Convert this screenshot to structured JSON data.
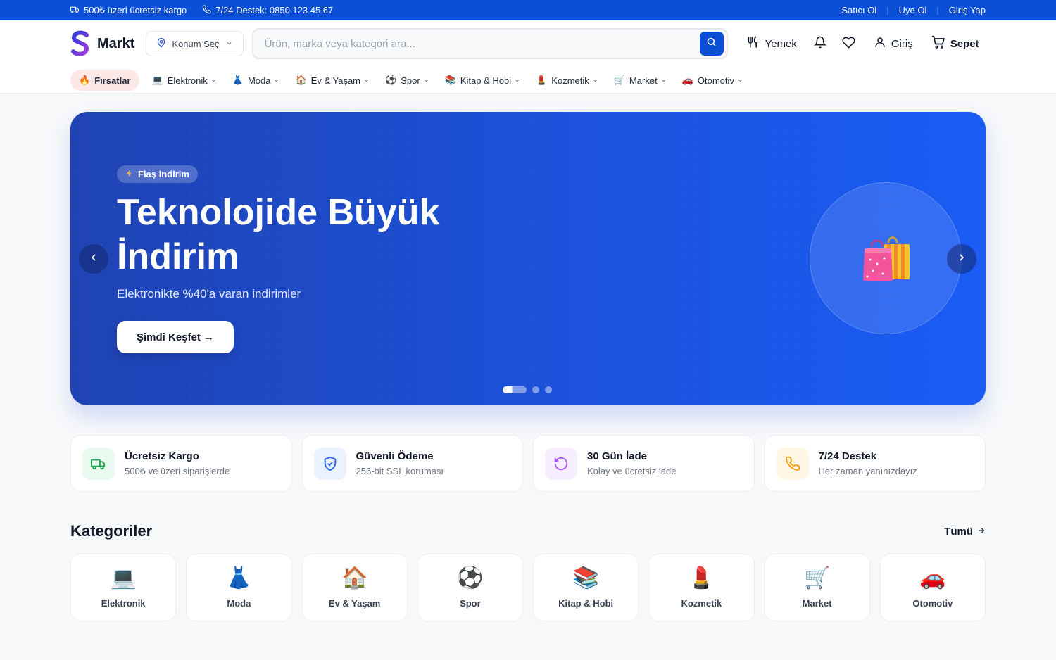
{
  "topbar": {
    "shipping": "500₺ üzeri ücretsiz kargo",
    "support": "7/24 Destek: 0850 123 45 67",
    "links": [
      "Satıcı Ol",
      "Üye Ol",
      "Giriş Yap"
    ]
  },
  "header": {
    "brand": "Markt",
    "location_label": "Konum Seç",
    "search_placeholder": "Ürün, marka veya kategori ara...",
    "actions": {
      "food": "Yemek",
      "login": "Giriş",
      "cart": "Sepet"
    }
  },
  "nav": {
    "deals": {
      "emoji": "🔥",
      "label": "Fırsatlar"
    },
    "items": [
      {
        "emoji": "💻",
        "label": "Elektronik"
      },
      {
        "emoji": "👗",
        "label": "Moda"
      },
      {
        "emoji": "🏠",
        "label": "Ev & Yaşam"
      },
      {
        "emoji": "⚽",
        "label": "Spor"
      },
      {
        "emoji": "📚",
        "label": "Kitap & Hobi"
      },
      {
        "emoji": "💄",
        "label": "Kozmetik"
      },
      {
        "emoji": "🛒",
        "label": "Market"
      },
      {
        "emoji": "🚗",
        "label": "Otomotiv"
      }
    ]
  },
  "hero": {
    "badge": "Flaş İndirim",
    "title": "Teknolojide Büyük İndirim",
    "subtitle": "Elektronikte %40'a varan indirimler",
    "cta": "Şimdi Keşfet →",
    "slide_count": 3,
    "active_slide": 1
  },
  "features": [
    {
      "icon": "truck-icon",
      "title": "Ücretsiz Kargo",
      "subtitle": "500₺ ve üzeri siparişlerde",
      "color": "#16a34a",
      "bg": "#e9f9ef"
    },
    {
      "icon": "shield-icon",
      "title": "Güvenli Ödeme",
      "subtitle": "256-bit SSL koruması",
      "color": "#2563eb",
      "bg": "#eaf1ff"
    },
    {
      "icon": "refresh-icon",
      "title": "30 Gün İade",
      "subtitle": "Kolay ve ücretsiz iade",
      "color": "#a855f7",
      "bg": "#f6edff"
    },
    {
      "icon": "phone-icon",
      "title": "7/24 Destek",
      "subtitle": "Her zaman yanınızdayız",
      "color": "#f59e0b",
      "bg": "#fff6e6"
    }
  ],
  "categories": {
    "title": "Kategoriler",
    "all_label": "Tümü",
    "items": [
      {
        "emoji": "💻",
        "label": "Elektronik"
      },
      {
        "emoji": "👗",
        "label": "Moda"
      },
      {
        "emoji": "🏠",
        "label": "Ev & Yaşam"
      },
      {
        "emoji": "⚽",
        "label": "Spor"
      },
      {
        "emoji": "📚",
        "label": "Kitap & Hobi"
      },
      {
        "emoji": "💄",
        "label": "Kozmetik"
      },
      {
        "emoji": "🛒",
        "label": "Market"
      },
      {
        "emoji": "🚗",
        "label": "Otomotiv"
      }
    ]
  },
  "colors": {
    "primary": "#0a4fd6",
    "deals_bg": "#fde8e8"
  }
}
